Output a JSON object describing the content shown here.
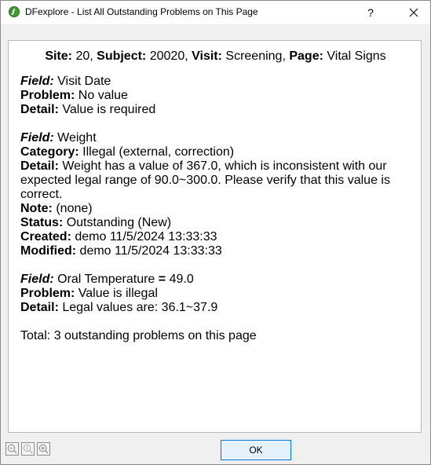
{
  "window": {
    "title": "DFexplore - List All Outstanding Problems on This Page",
    "help_label": "?"
  },
  "header": {
    "site_label": "Site:",
    "site_value": "20,",
    "subject_label": "Subject:",
    "subject_value": "20020,",
    "visit_label": "Visit:",
    "visit_value": "Screening,",
    "page_label": "Page:",
    "page_value": "Vital Signs"
  },
  "problems": [
    {
      "field_label": "Field:",
      "field_value": "Visit Date",
      "problem_label": "Problem:",
      "problem_value": "No value",
      "detail_label": "Detail:",
      "detail_value": "Value is required"
    },
    {
      "field_label": "Field:",
      "field_value": "Weight",
      "category_label": "Category:",
      "category_value": "Illegal (external, correction)",
      "detail_label": "Detail:",
      "detail_value": "Weight has a value of 367.0, which is inconsistent with our expected legal range of 90.0~300.0. Please verify that this value is correct.",
      "note_label": "Note:",
      "note_value": "(none)",
      "status_label": "Status:",
      "status_value": "Outstanding (New)",
      "created_label": "Created:",
      "created_value": "demo 11/5/2024 13:33:33",
      "modified_label": "Modified:",
      "modified_value": "demo 11/5/2024 13:33:33"
    },
    {
      "field_label": "Field:",
      "field_value": "Oral Temperature",
      "equals": "=",
      "field_extra": "49.0",
      "problem_label": "Problem:",
      "problem_value": "Value is illegal",
      "detail_label": "Detail:",
      "detail_value": "Legal values are: 36.1~37.9"
    }
  ],
  "total_text": "Total: 3 outstanding problems on this page",
  "footer": {
    "ok_label": "OK"
  },
  "icons": {
    "app": "dfexplore-app-icon",
    "close": "close-icon",
    "zoom_out": "zoom-out-icon",
    "zoom_reset": "zoom-reset-icon",
    "zoom_in": "zoom-in-icon"
  }
}
